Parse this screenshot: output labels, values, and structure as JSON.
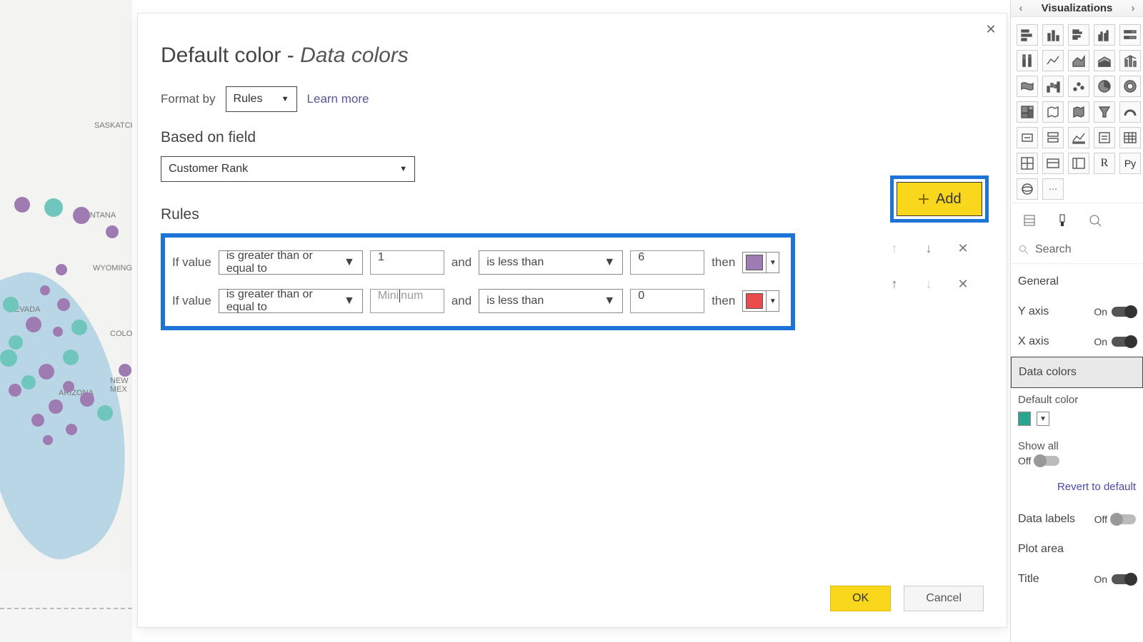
{
  "dialog": {
    "title_prefix": "Default color - ",
    "title_sub": "Data colors",
    "format_by_label": "Format by",
    "format_by_value": "Rules",
    "learn_more": "Learn more",
    "based_on_field_label": "Based on field",
    "based_on_field_value": "Customer Rank",
    "rules_label": "Rules",
    "add_label": "Add",
    "rules": [
      {
        "if_label": "If value",
        "op1": "is greater than or equal to",
        "val1": "1",
        "and": "and",
        "op2": "is less than",
        "val2": "6",
        "then": "then",
        "color": "#9e7bb0"
      },
      {
        "if_label": "If value",
        "op1": "is greater than or equal to",
        "val1": "",
        "val1_placeholder": "Minimum",
        "and": "and",
        "op2": "is less than",
        "val2": "0",
        "then": "then",
        "color": "#e84c4c"
      }
    ],
    "ok": "OK",
    "cancel": "Cancel"
  },
  "viz": {
    "title": "Visualizations",
    "search": "Search",
    "props": {
      "general": "General",
      "yaxis": "Y axis",
      "xaxis": "X axis",
      "datacolors": "Data colors",
      "default_color_label": "Default color",
      "default_color": "#2aa58f",
      "show_all": "Show all",
      "revert": "Revert to default",
      "datalabels": "Data labels",
      "plotarea": "Plot area",
      "title_prop": "Title",
      "on": "On",
      "off": "Off"
    }
  },
  "map": {
    "labels": [
      "SASKATCH",
      "MONTANA",
      "WYOMING",
      "NEVADA",
      "ARIZONA",
      "COLOF",
      "NEW MEX"
    ]
  }
}
